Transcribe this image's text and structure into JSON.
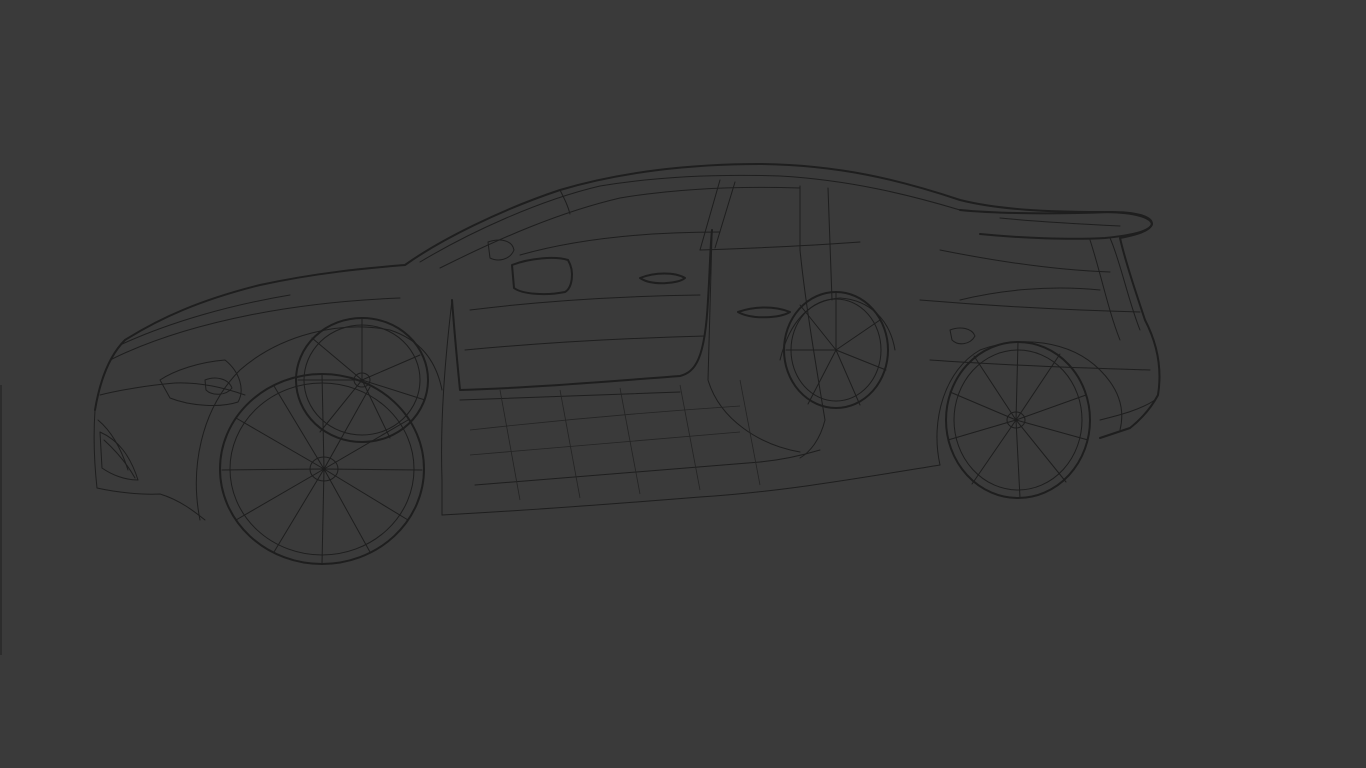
{
  "viewport": {
    "background_color": "#3a3a3a",
    "wire_color": "#1e1e1e",
    "display_mode": "wireframe"
  }
}
